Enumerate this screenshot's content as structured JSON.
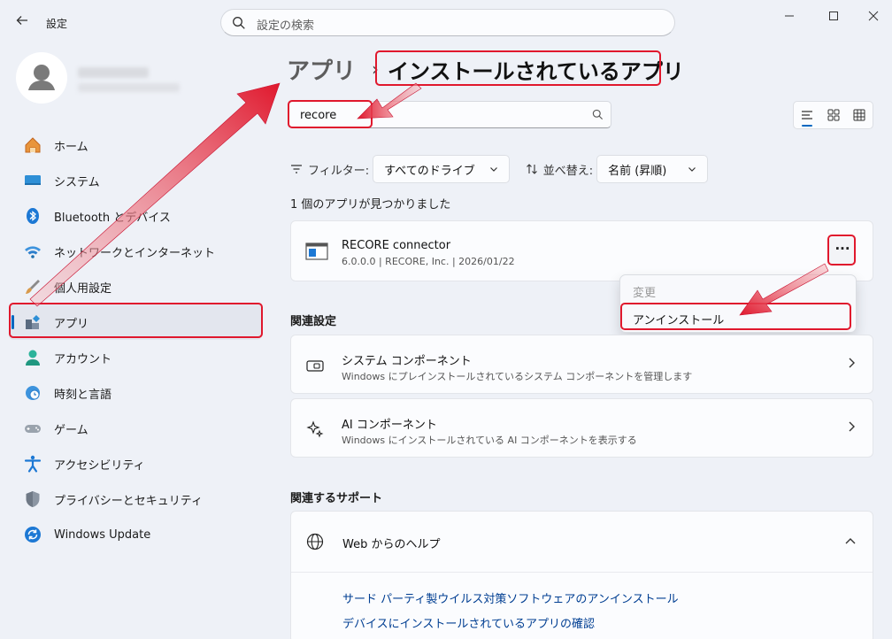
{
  "window": {
    "title": "設定",
    "search_placeholder": "設定の検索"
  },
  "sidebar": {
    "items": [
      {
        "label": "ホーム",
        "icon": "home-icon"
      },
      {
        "label": "システム",
        "icon": "system-icon"
      },
      {
        "label": "Bluetooth とデバイス",
        "icon": "bluetooth-icon"
      },
      {
        "label": "ネットワークとインターネット",
        "icon": "wifi-icon"
      },
      {
        "label": "個人用設定",
        "icon": "brush-icon"
      },
      {
        "label": "アプリ",
        "icon": "apps-icon",
        "active": true
      },
      {
        "label": "アカウント",
        "icon": "account-icon"
      },
      {
        "label": "時刻と言語",
        "icon": "time-language-icon"
      },
      {
        "label": "ゲーム",
        "icon": "gamepad-icon"
      },
      {
        "label": "アクセシビリティ",
        "icon": "accessibility-icon"
      },
      {
        "label": "プライバシーとセキュリティ",
        "icon": "shield-icon"
      },
      {
        "label": "Windows Update",
        "icon": "update-icon"
      }
    ]
  },
  "breadcrumb": {
    "root": "アプリ",
    "separator": "›",
    "current": "インストールされているアプリ"
  },
  "app_search": {
    "value": "recore"
  },
  "filters": {
    "filter_label": "フィルター:",
    "filter_value": "すべてのドライブ",
    "sort_label": "並べ替え:",
    "sort_value": "名前 (昇順)"
  },
  "results_count": "1 個のアプリが見つかりました",
  "app": {
    "name": "RECORE connector",
    "meta": "6.0.0.0  |  RECORE, Inc.  |  2026/01/22",
    "more_label": "···"
  },
  "context_menu": {
    "modify": "変更",
    "uninstall": "アンインストール"
  },
  "related_settings": {
    "heading": "関連設定",
    "rows": [
      {
        "title": "システム コンポーネント",
        "desc": "Windows にプレインストールされているシステム コンポーネントを管理します"
      },
      {
        "title": "AI コンポーネント",
        "desc": "Windows にインストールされている AI コンポーネントを表示する"
      }
    ]
  },
  "support": {
    "heading": "関連するサポート",
    "help_title": "Web からのヘルプ",
    "links": [
      "サード パーティ製ウイルス対策ソフトウェアのアンインストール",
      "デバイスにインストールされているアプリの確認"
    ]
  },
  "colors": {
    "accent": "#0067c0",
    "annotation": "#e0182d",
    "link": "#003e92"
  }
}
